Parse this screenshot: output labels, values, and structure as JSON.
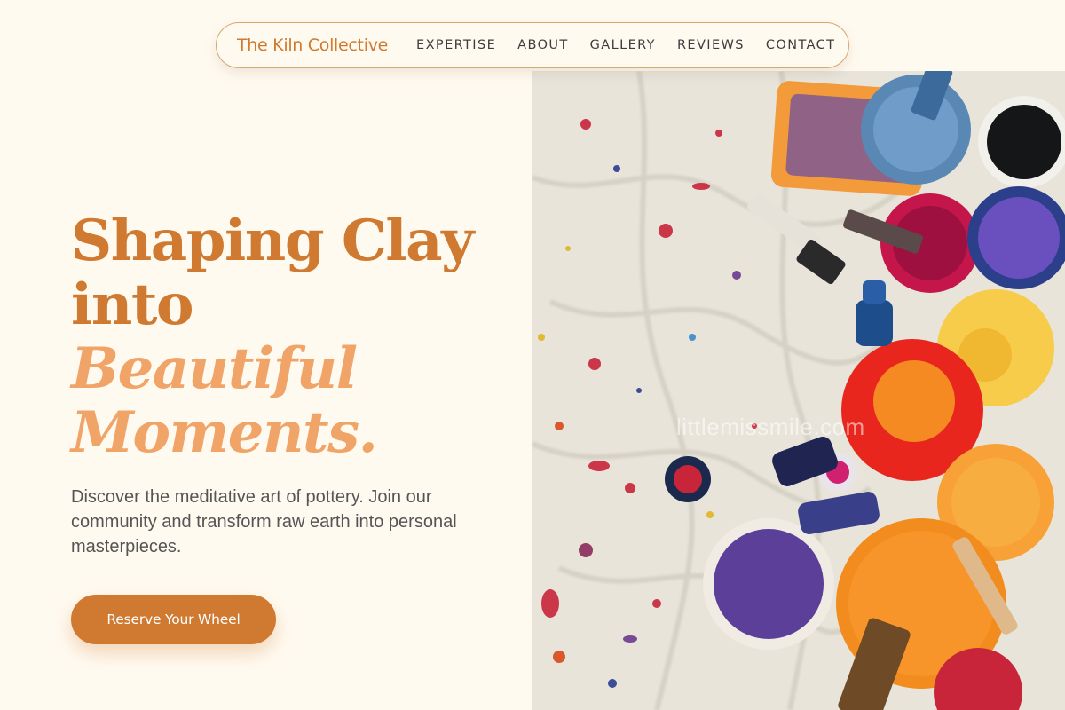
{
  "nav": {
    "brand": "The Kiln Collective",
    "links": [
      "EXPERTISE",
      "ABOUT",
      "GALLERY",
      "REVIEWS",
      "CONTACT"
    ]
  },
  "hero": {
    "headline_line1": "Shaping Clay",
    "headline_line2": "into",
    "headline_accent1": "Beautiful",
    "headline_accent2": "Moments.",
    "subcopy": "Discover the meditative art of pottery. Join our community and transform raw earth into personal masterpieces.",
    "cta_label": "Reserve Your Wheel",
    "image_watermark": "littlemissmile.com"
  },
  "colors": {
    "background": "#fffaf0",
    "brand": "#cf7a30",
    "accent": "#f0a468",
    "text": "#555555"
  },
  "icons": {
    "hero_image": "paint-palette-photo"
  }
}
